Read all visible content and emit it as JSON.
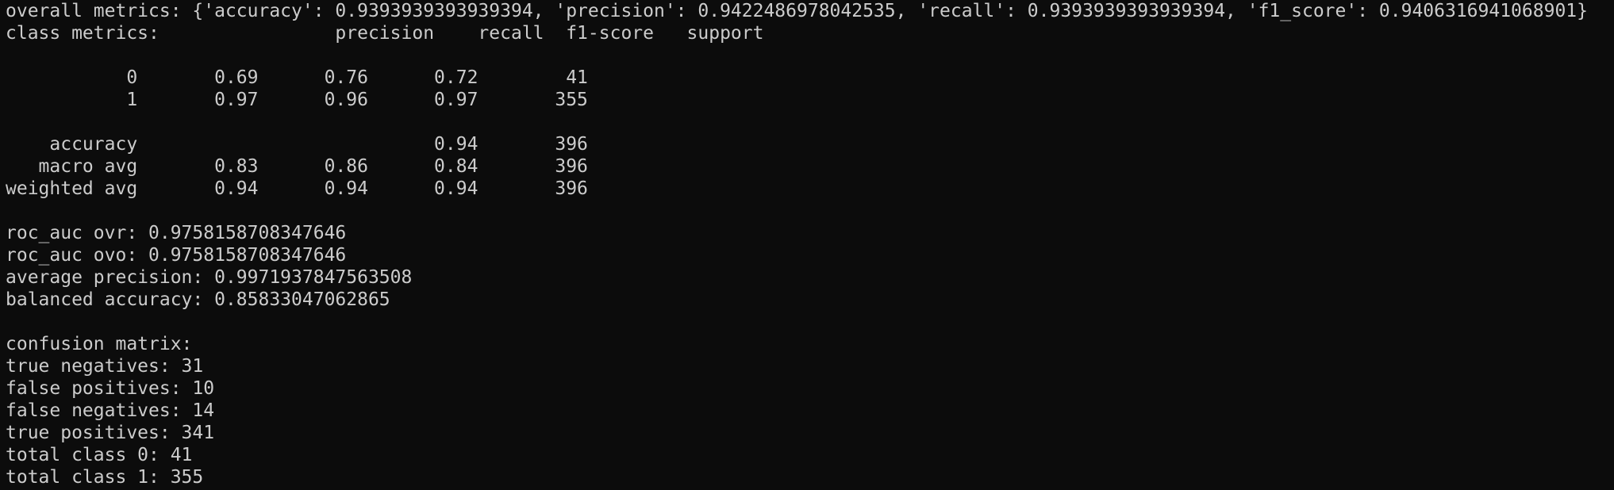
{
  "terminal": {
    "lines": [
      "overall metrics: {'accuracy': 0.9393939393939394, 'precision': 0.9422486978042535, 'recall': 0.9393939393939394, 'f1_score': 0.9406316941068901}",
      "class metrics:                precision    recall  f1-score   support",
      "",
      "           0       0.69      0.76      0.72        41",
      "           1       0.97      0.96      0.97       355",
      "",
      "    accuracy                           0.94       396",
      "   macro avg       0.83      0.86      0.84       396",
      "weighted avg       0.94      0.94      0.94       396",
      "",
      "roc_auc ovr: 0.9758158708347646",
      "roc_auc ovo: 0.9758158708347646",
      "average precision: 0.9971937847563508",
      "balanced accuracy: 0.85833047062865",
      "",
      "confusion matrix:",
      "true negatives: 31",
      "false positives: 10",
      "false negatives: 14",
      "true positives: 341",
      "total class 0: 41",
      "total class 1: 355"
    ]
  },
  "colors": {
    "background": "#0c0c0c",
    "foreground": "#cccccc"
  }
}
